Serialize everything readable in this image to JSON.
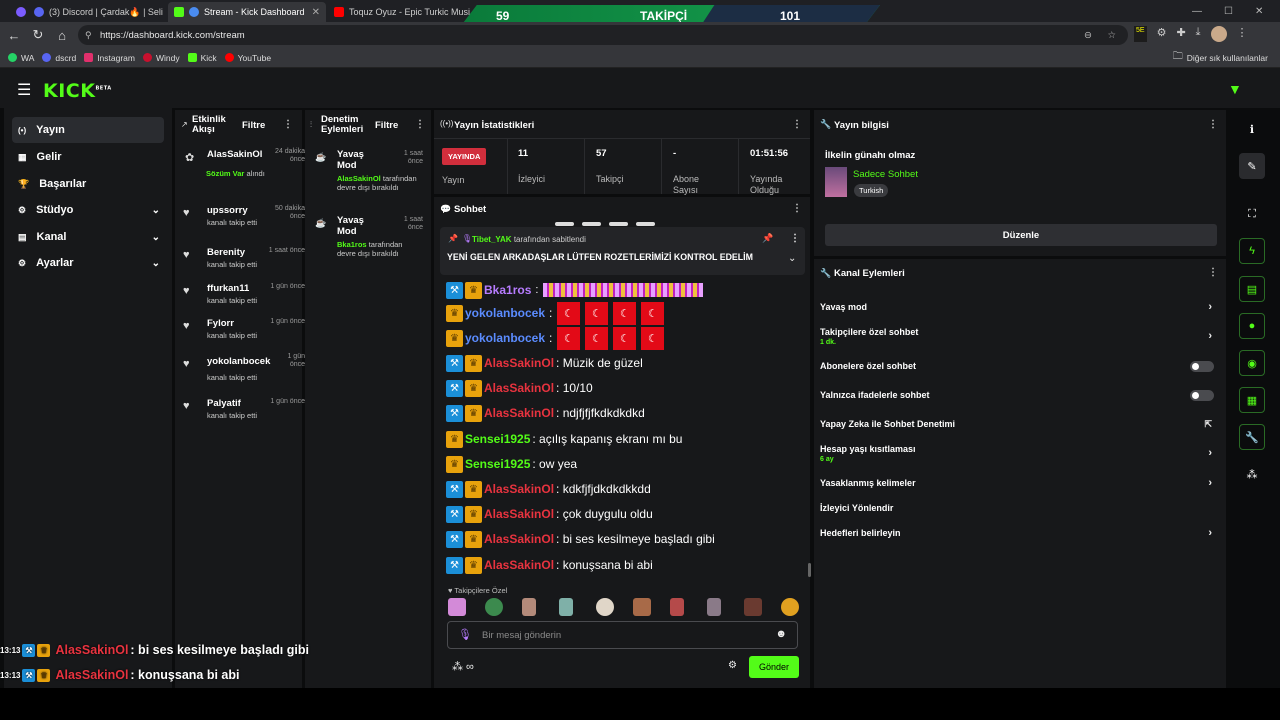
{
  "browser": {
    "tabs": [
      {
        "title": "(3) Discord | Çardak🔥 | Seli",
        "color": "#5865f2"
      },
      {
        "title": "Stream - Kick Dashboard",
        "color": "#53fc18"
      },
      {
        "title": "Toquz Oyuz - Epic Turkic Music",
        "color": "#ff0000"
      }
    ],
    "url": "https://dashboard.kick.com/stream",
    "bookmarks": [
      {
        "label": "WA",
        "color": "#25d366"
      },
      {
        "label": "dscrd",
        "color": "#5865f2"
      },
      {
        "label": "Instagram",
        "color": "#e1306c"
      },
      {
        "label": "Windy",
        "color": "#c8102e"
      },
      {
        "label": "Kick",
        "color": "#53fc18"
      },
      {
        "label": "YouTube",
        "color": "#ff0000"
      }
    ],
    "other_bookmarks": "Diğer sık kullanılanlar"
  },
  "follower_counter": {
    "left": "59",
    "label": "TAKİPÇİ",
    "right": "101"
  },
  "logo": "KICK",
  "logo_sup": "BETA",
  "sidebar": [
    {
      "label": "Yayın",
      "icon": "broadcast-icon",
      "glyph": "(•)"
    },
    {
      "label": "Gelir",
      "icon": "revenue-icon",
      "glyph": "▦"
    },
    {
      "label": "Başarılar",
      "icon": "trophy-icon",
      "glyph": "🏆"
    },
    {
      "label": "Stüdyo",
      "icon": "studio-icon",
      "glyph": "⚙"
    },
    {
      "label": "Kanal",
      "icon": "channel-icon",
      "glyph": "▤"
    },
    {
      "label": "Ayarlar",
      "icon": "settings-icon",
      "glyph": "⚙"
    }
  ],
  "activity": {
    "title": "Etkinlik Akışı",
    "filter": "Filtre",
    "items": [
      {
        "name": "AlasSakinOl",
        "sub_green": "Sözüm Var",
        "sub": "alındı",
        "time": "24 dakika önce"
      },
      {
        "name": "upssorry",
        "sub": "kanalı takip etti",
        "time": "50 dakika önce"
      },
      {
        "name": "Berenity",
        "sub": "kanalı takip etti",
        "time": "1 saat önce"
      },
      {
        "name": "ffurkan11",
        "sub": "kanalı takip etti",
        "time": "1 gün önce"
      },
      {
        "name": "Fylorr",
        "sub": "kanalı takip etti",
        "time": "1 gün önce"
      },
      {
        "name": "yokolanbocek",
        "sub": "kanalı takip etti",
        "time": "1 gün önce"
      },
      {
        "name": "Palyatif",
        "sub": "kanalı takip etti",
        "time": "1 gün önce"
      }
    ]
  },
  "moderation": {
    "title": "Denetim Eylemleri",
    "filter": "Filtre",
    "items": [
      {
        "action": "Yavaş Mod",
        "who": "AlasSakinOl",
        "rest": "tarafından devre dışı bırakıldı",
        "time": "1 saat önce"
      },
      {
        "action": "Yavaş Mod",
        "who": "Bka1ros",
        "rest": "tarafından devre dışı bırakıldı",
        "time": "1 saat önce"
      }
    ]
  },
  "stats": {
    "title": "Yayın İstatistikleri",
    "live_badge": "YAYINDA",
    "live_label": "Yayın",
    "items": [
      {
        "value": "11",
        "label": "İzleyici"
      },
      {
        "value": "57",
        "label": "Takipçi"
      },
      {
        "value": "-",
        "label": "Abone Sayısı"
      },
      {
        "value": "01:51:56",
        "label": "Yayında Olduğu"
      }
    ]
  },
  "chat": {
    "title": "Sohbet",
    "pinned_by": "Tibet_YAK",
    "pinned_by_suffix": "tarafından sabitlendi",
    "pinned_text": "YENİ GELEN ARKADAŞLAR LÜTFEN ROZETLERİMİZİ KONTROL EDELİM",
    "messages": [
      {
        "badges": [
          "mod",
          "sub"
        ],
        "user": "Bka1ros",
        "color": "#b77cff",
        "text": "",
        "emotes": "bars"
      },
      {
        "badges": [
          "sub"
        ],
        "user": "yokolanbocek",
        "color": "#5b8cff",
        "text": "",
        "emotes": "flags"
      },
      {
        "badges": [
          "sub"
        ],
        "user": "yokolanbocek",
        "color": "#5b8cff",
        "text": "",
        "emotes": "flags"
      },
      {
        "badges": [
          "mod",
          "sub"
        ],
        "user": "AlasSakinOl",
        "color": "#e8333f",
        "text": ": Müzik de güzel"
      },
      {
        "badges": [
          "mod",
          "sub"
        ],
        "user": "AlasSakinOl",
        "color": "#e8333f",
        "text": ": 10/10"
      },
      {
        "badges": [
          "mod",
          "sub"
        ],
        "user": "AlasSakinOl",
        "color": "#e8333f",
        "text": ": ndjfjfjfkdkdkdkd"
      },
      {
        "badges": [
          "sub"
        ],
        "user": "Sensei1925",
        "color": "#53fc18",
        "text": ": açılış kapanış ekranı mı bu"
      },
      {
        "badges": [
          "sub"
        ],
        "user": "Sensei1925",
        "color": "#53fc18",
        "text": ": ow yea"
      },
      {
        "badges": [
          "mod",
          "sub"
        ],
        "user": "AlasSakinOl",
        "color": "#e8333f",
        "text": ": kdkfjfjdkdkdkkdd"
      },
      {
        "badges": [
          "mod",
          "sub"
        ],
        "user": "AlasSakinOl",
        "color": "#e8333f",
        "text": ": çok duygulu oldu"
      },
      {
        "badges": [
          "mod",
          "sub"
        ],
        "user": "AlasSakinOl",
        "color": "#e8333f",
        "text": ": bi ses kesilmeye başladı gibi"
      },
      {
        "badges": [
          "mod",
          "sub"
        ],
        "user": "AlasSakinOl",
        "color": "#e8333f",
        "text": ": konuşsana bi abi"
      }
    ],
    "emote_section": "Takipçilere Özel",
    "input_placeholder": "Bir mesaj gönderin",
    "send": "Gönder"
  },
  "stream_info": {
    "title": "Yayın bilgisi",
    "stream_title": "İlkelin günahı olmaz",
    "category": "Sadece Sohbet",
    "language": "Turkish",
    "edit": "Düzenle"
  },
  "channel_actions": {
    "title": "Kanal Eylemleri",
    "items": [
      {
        "label": "Yavaş mod",
        "control": "arrow"
      },
      {
        "label": "Takipçilere özel sohbet",
        "sub": "1 dk.",
        "control": "arrow"
      },
      {
        "label": "Abonelere özel sohbet",
        "control": "toggle",
        "enabled": false
      },
      {
        "label": "Yalnızca ifadelerle sohbet",
        "control": "toggle",
        "enabled": false
      },
      {
        "label": "Yapay Zeka ile Sohbet Denetimi",
        "control": "external"
      },
      {
        "label": "Hesap yaşı kısıtlaması",
        "sub": "6 ay",
        "control": "arrow"
      },
      {
        "label": "Yasaklanmış kelimeler",
        "control": "arrow"
      },
      {
        "label": "İzleyici Yönlendir",
        "control": "none"
      },
      {
        "label": "Hedefleri belirleyin",
        "control": "arrow"
      }
    ]
  },
  "overlay_chat": [
    {
      "time": "13:13",
      "user": "AlasSakinOl",
      "text": ": bi ses kesilmeye başladı gibi"
    },
    {
      "time": "13:13",
      "user": "AlasSakinOl",
      "text": ": konuşsana bi abi"
    }
  ]
}
